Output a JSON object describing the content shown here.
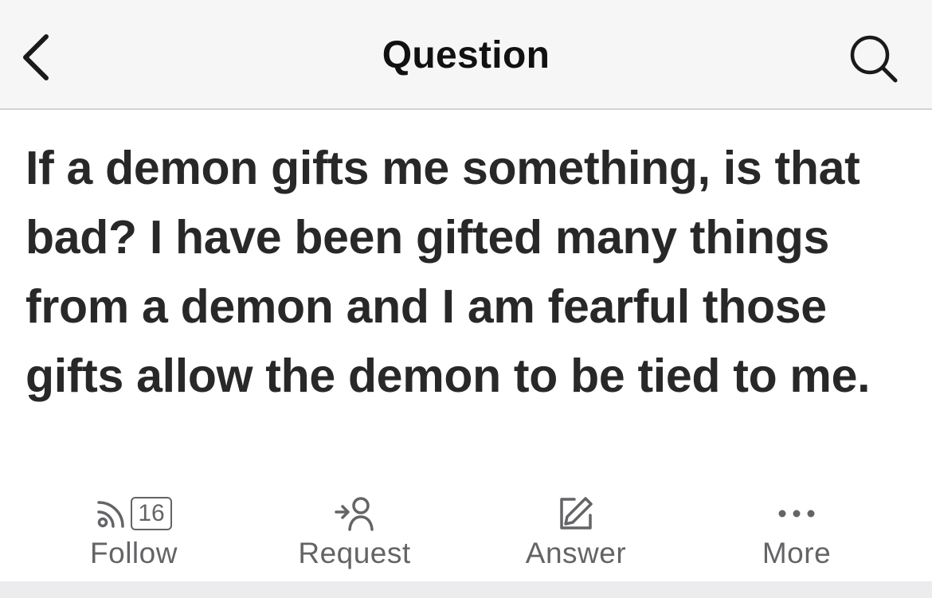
{
  "header": {
    "title": "Question",
    "back_icon": "chevron-left-icon",
    "search_icon": "search-icon"
  },
  "question": {
    "text": "If a demon gifts me something, is that bad? I have been gifted many things from a demon and I am fearful those gifts allow the demon to be tied to me."
  },
  "actions": {
    "follow": {
      "label": "Follow",
      "count": "16",
      "icon": "follow-feed-icon"
    },
    "request": {
      "label": "Request",
      "icon": "request-user-icon"
    },
    "answer": {
      "label": "Answer",
      "icon": "pencil-edit-icon"
    },
    "more": {
      "label": "More",
      "icon": "more-dots-icon"
    }
  },
  "colors": {
    "header_bg": "#f6f6f6",
    "text_primary": "#282829",
    "text_secondary": "#636466",
    "divider": "#d4d4d4"
  }
}
